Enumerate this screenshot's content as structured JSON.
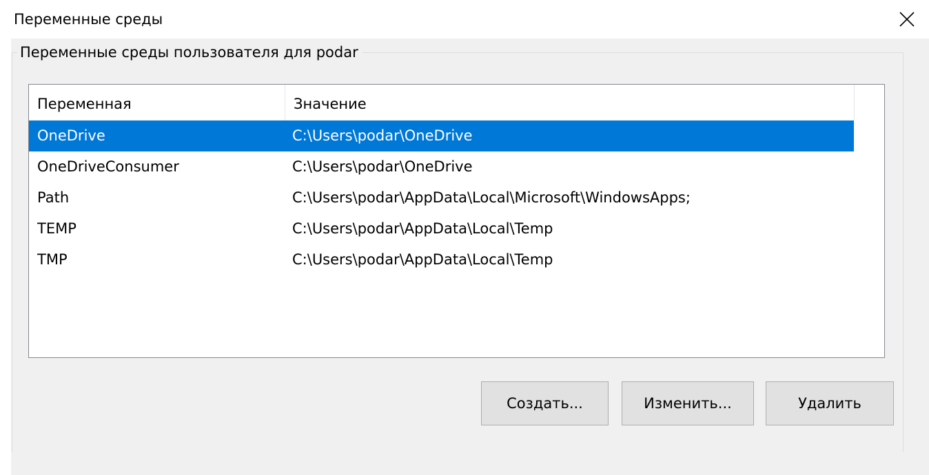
{
  "window": {
    "title": "Переменные среды"
  },
  "user_group": {
    "legend": "Переменные среды пользователя для podar",
    "columns": [
      "Переменная",
      "Значение"
    ],
    "rows": [
      {
        "name": "OneDrive",
        "value": "C:\\Users\\podar\\OneDrive",
        "selected": true
      },
      {
        "name": "OneDriveConsumer",
        "value": "C:\\Users\\podar\\OneDrive",
        "selected": false
      },
      {
        "name": "Path",
        "value": "C:\\Users\\podar\\AppData\\Local\\Microsoft\\WindowsApps;",
        "selected": false
      },
      {
        "name": "TEMP",
        "value": "C:\\Users\\podar\\AppData\\Local\\Temp",
        "selected": false
      },
      {
        "name": "TMP",
        "value": "C:\\Users\\podar\\AppData\\Local\\Temp",
        "selected": false
      }
    ],
    "buttons": {
      "new_label": "Создать...",
      "edit_label": "Изменить...",
      "delete_label": "Удалить"
    }
  },
  "colors": {
    "selection": "#0078d7",
    "dialog_background": "#f0f0f0"
  },
  "icons": {
    "close": "close-icon"
  }
}
